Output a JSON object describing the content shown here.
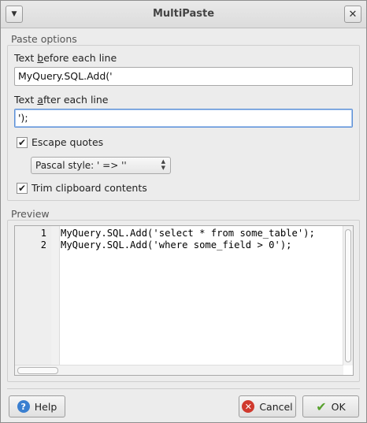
{
  "window": {
    "title": "MultiPaste",
    "menu_icon": "chevron-down-icon",
    "close_icon": "close-icon"
  },
  "paste_options": {
    "group_label": "Paste options",
    "before_label_pre": "Text ",
    "before_label_mnemonic": "b",
    "before_label_post": "efore each line",
    "before_value": "MyQuery.SQL.Add('",
    "after_label_pre": "Text ",
    "after_label_mnemonic": "a",
    "after_label_post": "fter each line",
    "after_value": "');",
    "escape_quotes_label": "Escape quotes",
    "escape_quotes_checked": true,
    "escape_style_value": "Pascal style: ' => ''",
    "trim_label": "Trim clipboard contents",
    "trim_checked": true
  },
  "preview": {
    "group_label": "Preview",
    "line_numbers": [
      "1",
      "2"
    ],
    "lines": [
      "MyQuery.SQL.Add('select * from some_table');",
      "MyQuery.SQL.Add('where some_field > 0');"
    ]
  },
  "buttons": {
    "help_label": "Help",
    "cancel_label": "Cancel",
    "ok_label": "OK",
    "help_icon": "help-icon",
    "cancel_icon": "cancel-icon",
    "ok_icon": "checkmark-icon"
  },
  "colors": {
    "help_icon": "#3a7fd0",
    "cancel_icon": "#d03a2e",
    "ok_icon": "#58a12e",
    "focus_border": "#5b8fd6"
  }
}
